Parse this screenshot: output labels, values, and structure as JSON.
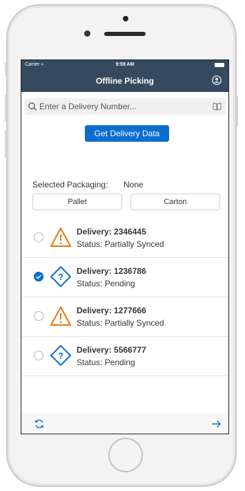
{
  "status_bar": {
    "carrier": "Carrier ≈",
    "time": "9:59 AM"
  },
  "nav": {
    "title": "Offline Picking"
  },
  "search": {
    "placeholder": "Enter a Delivery Number..."
  },
  "actions": {
    "get_data_label": "Get Delivery Data"
  },
  "packaging": {
    "label": "Selected Packaging:",
    "value": "None",
    "options": [
      "Pallet",
      "Carton"
    ]
  },
  "deliveries": [
    {
      "title": "Delivery: 2346445",
      "status": "Status: Partially Synced",
      "icon": "warning-icon",
      "selected": false
    },
    {
      "title": "Delivery: 1236786",
      "status": "Status: Pending",
      "icon": "pending-icon",
      "selected": true
    },
    {
      "title": "Delivery: 1277666",
      "status": "Status: Partially Synced",
      "icon": "warning-icon",
      "selected": false
    },
    {
      "title": "Delivery: 5566777",
      "status": "Status: Pending",
      "icon": "pending-icon",
      "selected": false
    }
  ],
  "colors": {
    "header": "#354a5f",
    "accent": "#0a6ed1",
    "warning": "#e9730c"
  }
}
